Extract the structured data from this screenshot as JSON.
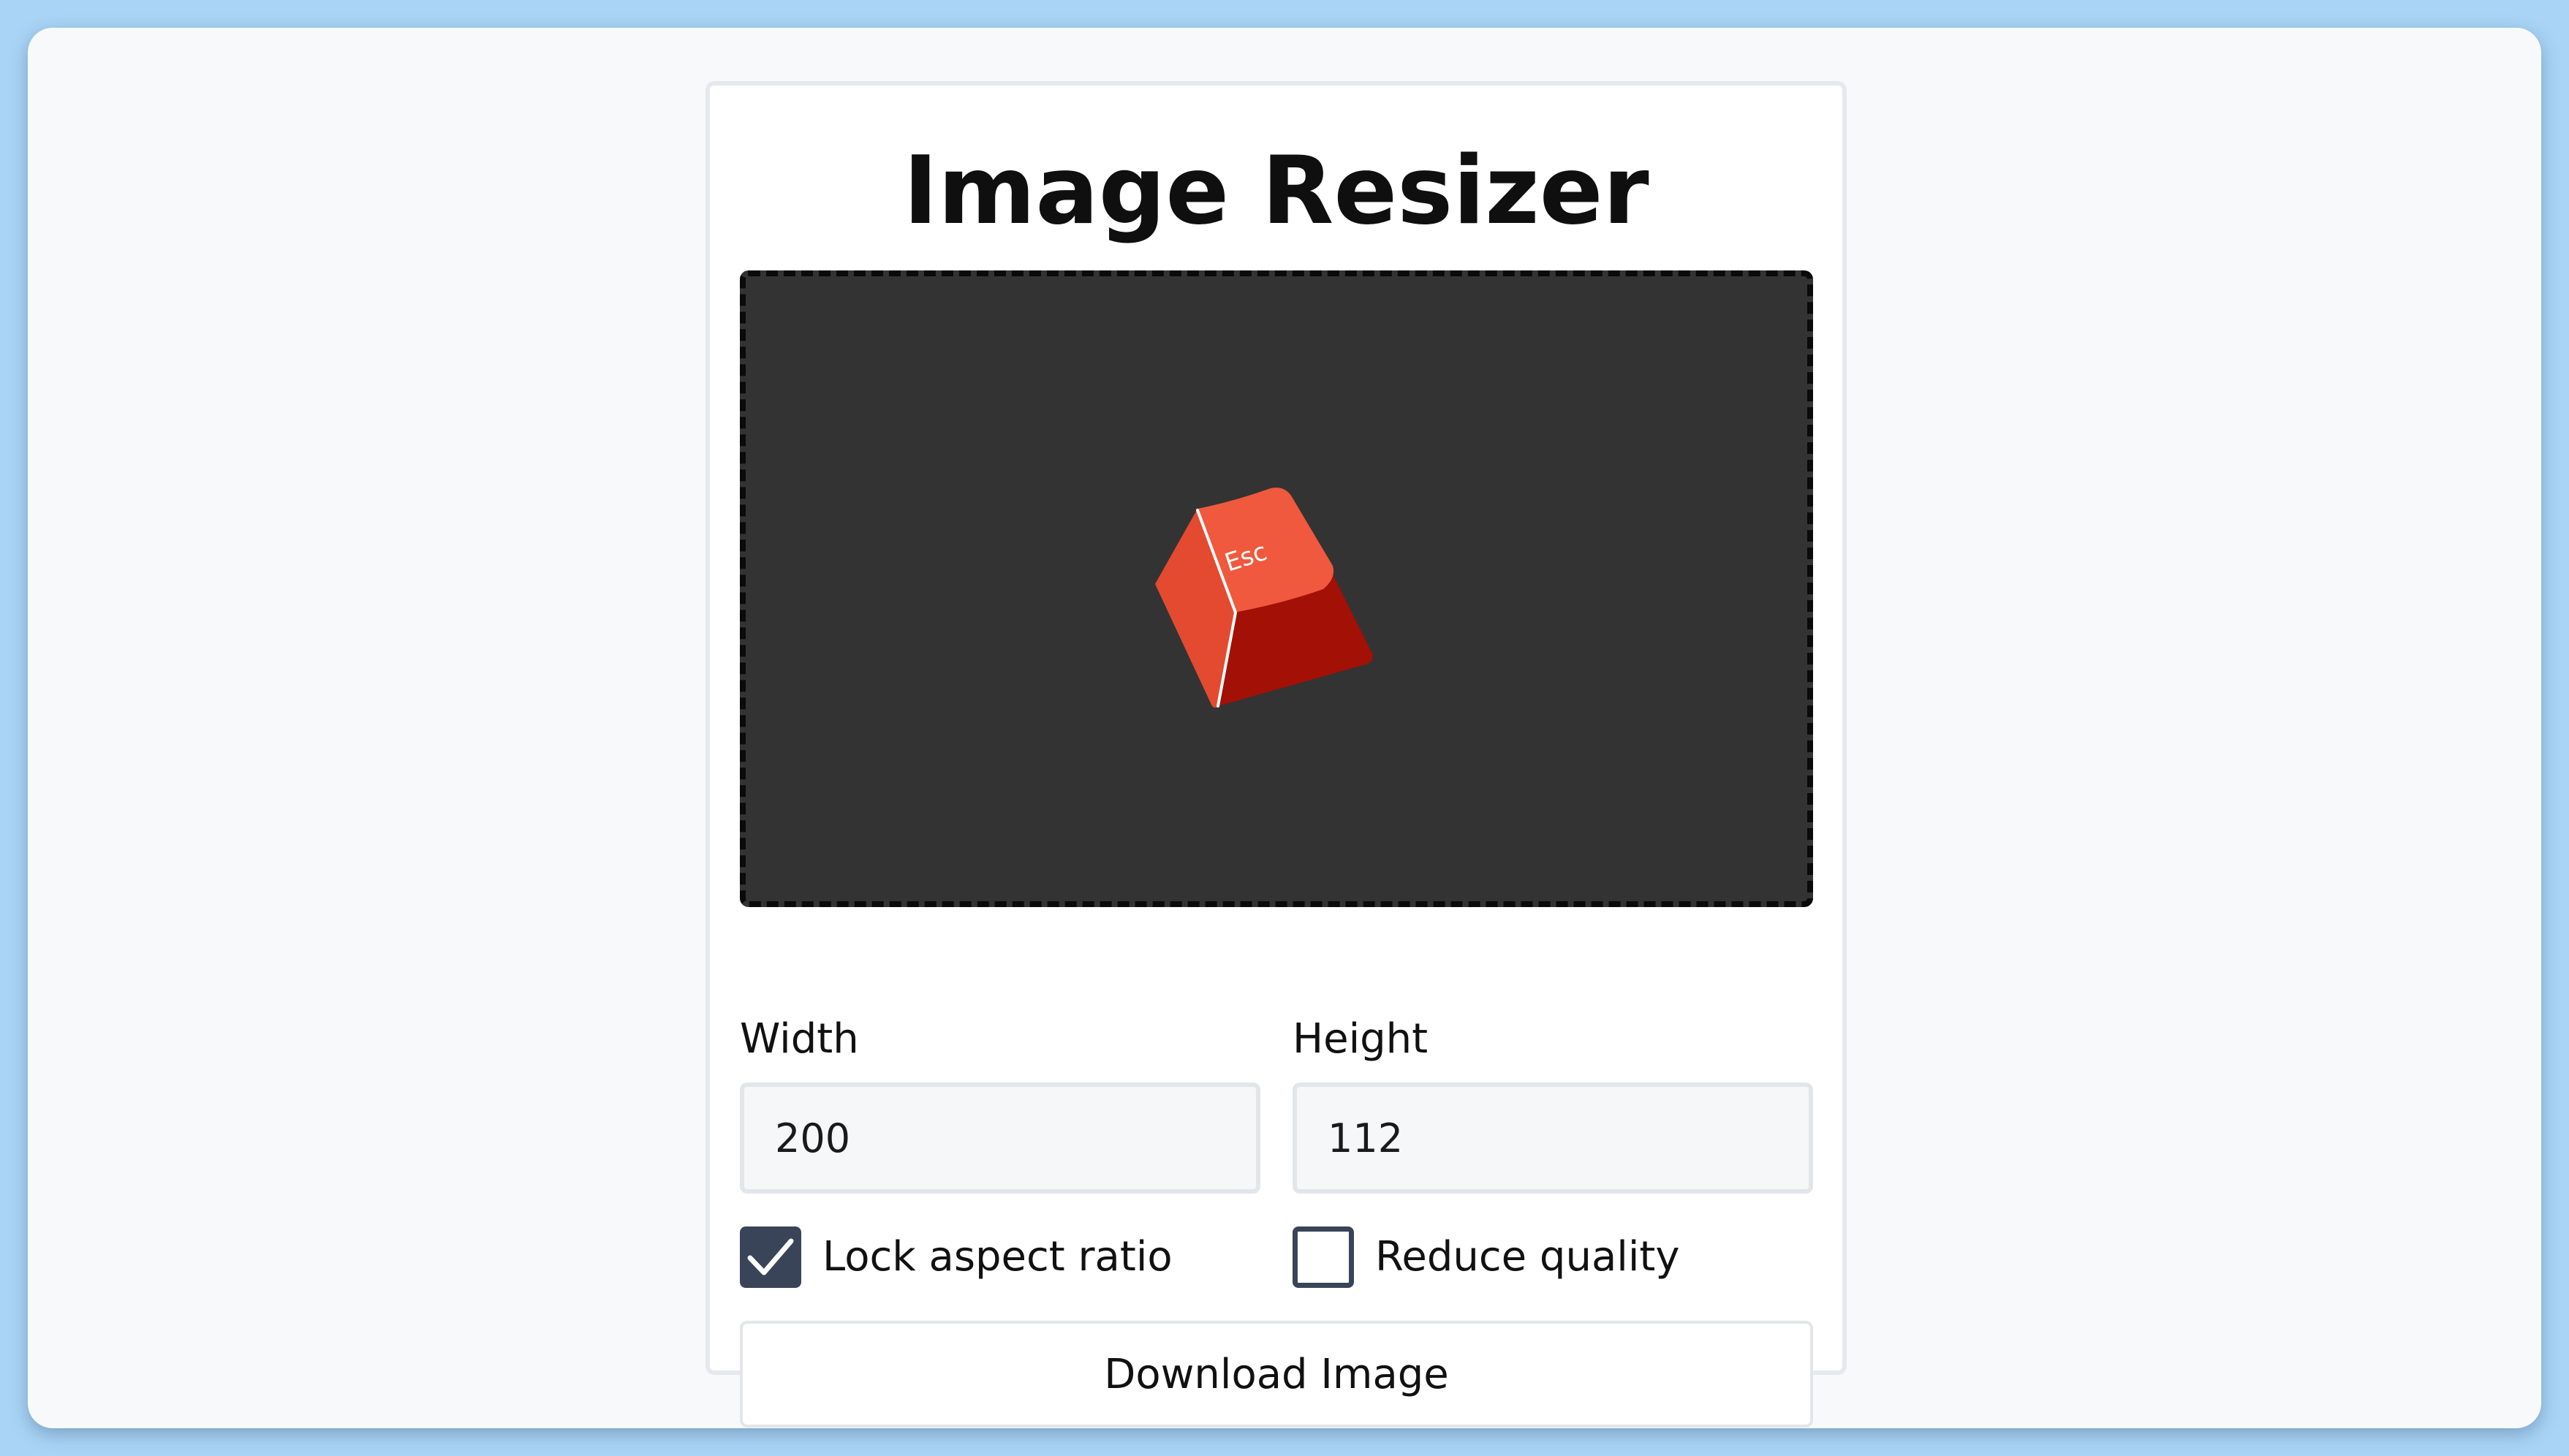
{
  "app": {
    "title": "Image Resizer"
  },
  "preview": {
    "image_icon": "esc-keycap-image",
    "keycap_text": "Esc",
    "colors": {
      "background": "#333333",
      "keycap_top": "#f0593d",
      "keycap_side": "#a31005"
    }
  },
  "fields": {
    "width": {
      "label": "Width",
      "value": "200"
    },
    "height": {
      "label": "Height",
      "value": "112"
    }
  },
  "options": {
    "lock_aspect_ratio": {
      "label": "Lock aspect ratio",
      "checked": true
    },
    "reduce_quality": {
      "label": "Reduce quality",
      "checked": false
    }
  },
  "actions": {
    "download_label": "Download Image"
  },
  "colors": {
    "outer_background": "#a9d4f5",
    "window_background": "#f7f9fb",
    "checkbox_accent": "#3a4458"
  }
}
